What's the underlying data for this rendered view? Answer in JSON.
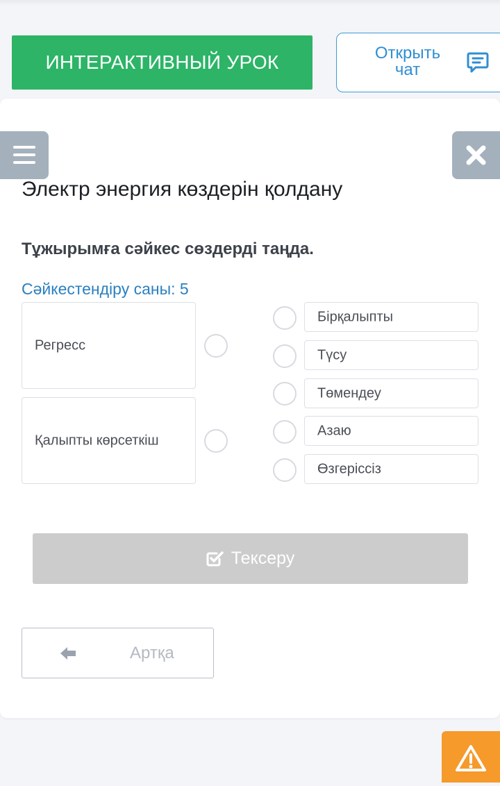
{
  "header": {
    "interactive_lesson_label": "ИНТЕРАКТИВНЫЙ УРОК",
    "open_chat_line1": "Открыть",
    "open_chat_line2": "чат",
    "accent_green": "#2db467",
    "accent_blue": "#2f8ed3"
  },
  "lesson": {
    "title": "Электр энергия көздерін қолдану",
    "instruction": "Тұжырымға сәйкес сөздерді таңда.",
    "match_count": "Сәйкестендіру саны: 5"
  },
  "terms": [
    {
      "label": "Регресс"
    },
    {
      "label": "Қалыпты көрсеткіш"
    }
  ],
  "options": [
    {
      "label": "Бірқалыпты"
    },
    {
      "label": "Түсу"
    },
    {
      "label": "Төмендеу"
    },
    {
      "label": "Азаю"
    },
    {
      "label": "Өзгеріссіз"
    }
  ],
  "actions": {
    "check_label": "Тексеру",
    "back_label": "Артқа"
  },
  "icons": {
    "menu": "hamburger-menu-icon",
    "close": "close-icon",
    "chat": "chat-bubble-icon",
    "check": "checkbox-check-icon",
    "back": "arrow-left-icon",
    "warning": "warning-triangle-icon"
  }
}
